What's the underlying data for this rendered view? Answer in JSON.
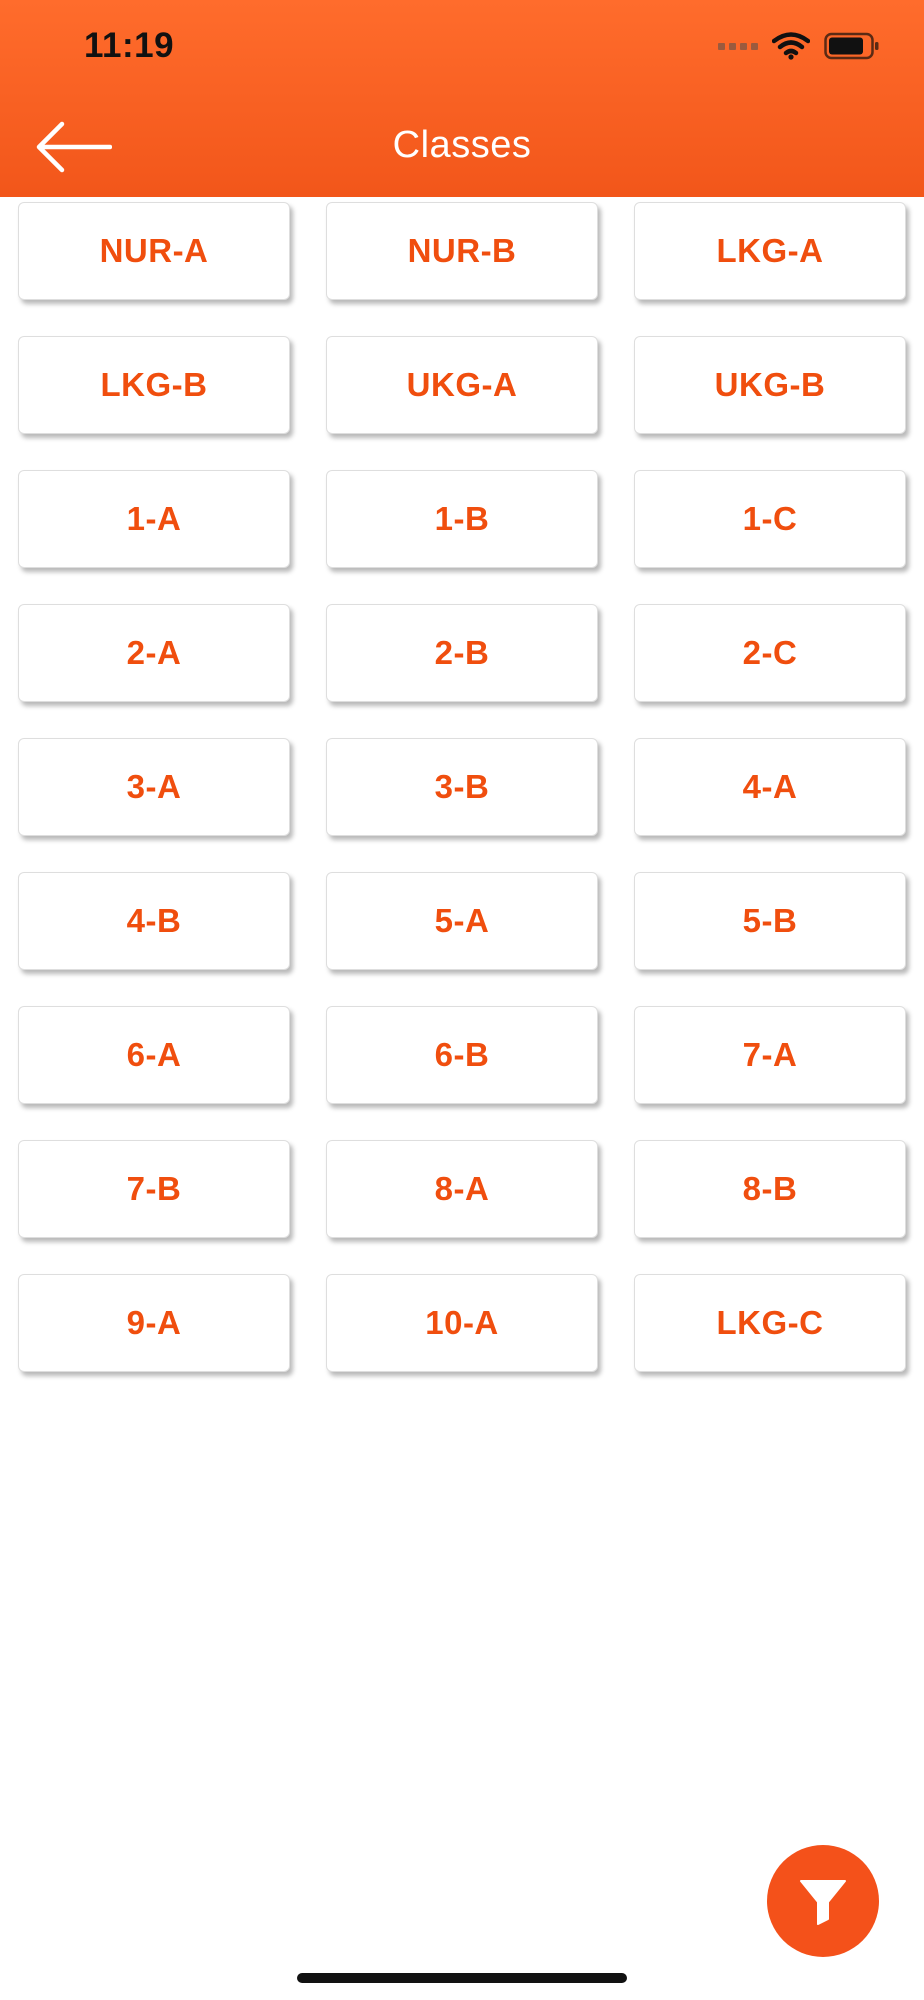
{
  "status": {
    "time": "11:19"
  },
  "header": {
    "title": "Classes"
  },
  "classes": [
    "NUR-A",
    "NUR-B",
    "LKG-A",
    "LKG-B",
    "UKG-A",
    "UKG-B",
    "1-A",
    "1-B",
    "1-C",
    "2-A",
    "2-B",
    "2-C",
    "3-A",
    "3-B",
    "4-A",
    "4-B",
    "5-A",
    "5-B",
    "6-A",
    "6-B",
    "7-A",
    "7-B",
    "8-A",
    "8-B",
    "9-A",
    "10-A",
    "LKG-C"
  ],
  "icons": {
    "back": "arrow-left-icon",
    "filter": "filter-icon",
    "wifi": "wifi-icon",
    "battery": "battery-icon",
    "signal": "cellular-signal-icon"
  },
  "colors": {
    "accent": "#F4511A",
    "header_top": "#FF6C2C",
    "header_bottom": "#F2561A",
    "label": "#F04E0E"
  }
}
